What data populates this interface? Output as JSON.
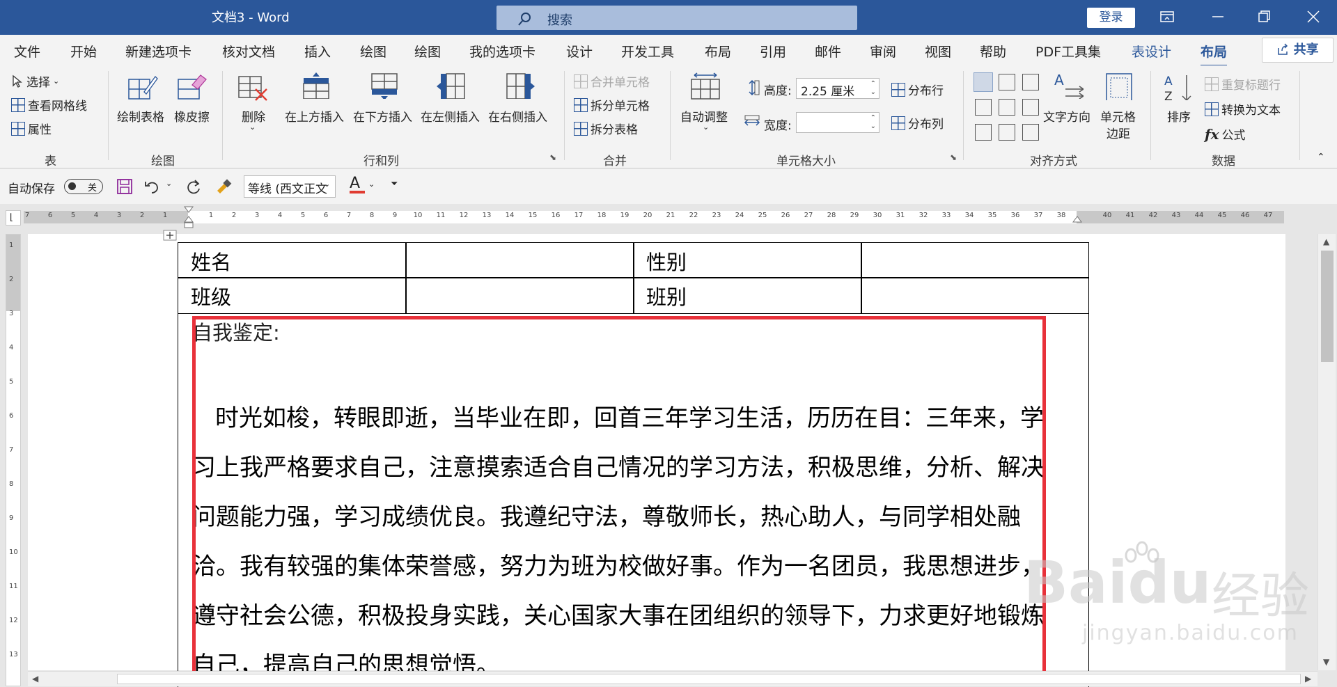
{
  "titlebar": {
    "doc_title": "文档3  -  Word",
    "search_placeholder": "搜索",
    "login_label": "登录"
  },
  "tabs": [
    {
      "label": "文件"
    },
    {
      "label": "开始"
    },
    {
      "label": "新建选项卡"
    },
    {
      "label": "核对文档"
    },
    {
      "label": "插入"
    },
    {
      "label": "绘图"
    },
    {
      "label": "绘图"
    },
    {
      "label": "我的选项卡"
    },
    {
      "label": "设计"
    },
    {
      "label": "开发工具"
    },
    {
      "label": "布局"
    },
    {
      "label": "引用"
    },
    {
      "label": "邮件"
    },
    {
      "label": "审阅"
    },
    {
      "label": "视图"
    },
    {
      "label": "帮助"
    },
    {
      "label": "PDF工具集"
    },
    {
      "label": "表设计"
    },
    {
      "label": "布局"
    }
  ],
  "share_label": "共享",
  "ribbon": {
    "table": {
      "select": "选择",
      "view_grid": "查看网格线",
      "properties": "属性",
      "group": "表"
    },
    "draw": {
      "draw_table": "绘制表格",
      "eraser": "橡皮擦",
      "group": "绘图"
    },
    "rows_cols": {
      "delete": "删除",
      "insert_above": "在上方插入",
      "insert_below": "在下方插入",
      "insert_left": "在左侧插入",
      "insert_right": "在右侧插入",
      "group": "行和列"
    },
    "merge": {
      "merge_cells": "合并单元格",
      "split_cells": "拆分单元格",
      "split_table": "拆分表格",
      "group": "合并"
    },
    "cell_size": {
      "autofit": "自动调整",
      "height_label": "高度:",
      "height_value": "2.25 厘米",
      "width_label": "宽度:",
      "width_value": "",
      "distribute_rows": "分布行",
      "distribute_cols": "分布列",
      "group": "单元格大小"
    },
    "alignment": {
      "text_direction": "文字方向",
      "cell_margins_1": "单元格",
      "cell_margins_2": "边距",
      "group": "对齐方式"
    },
    "data": {
      "sort": "排序",
      "repeat_header": "重复标题行",
      "convert_text": "转换为文本",
      "formula": "公式",
      "group": "数据"
    }
  },
  "qat": {
    "autosave_label": "自动保存",
    "autosave_state": "关",
    "font_name": "等线 (西文正文"
  },
  "ruler": {
    "left_numbers": [
      "7",
      "6",
      "5",
      "4",
      "3",
      "2",
      "1"
    ],
    "right_numbers": [
      "1",
      "2",
      "3",
      "4",
      "5",
      "6",
      "7",
      "8",
      "9",
      "10",
      "11",
      "12",
      "13",
      "14",
      "15",
      "16",
      "17",
      "18",
      "19",
      "20",
      "21",
      "22",
      "23",
      "24",
      "25",
      "26",
      "27",
      "28",
      "29",
      "30",
      "31",
      "32",
      "33",
      "34",
      "35",
      "36",
      "37",
      "38"
    ],
    "margin_numbers": [
      "40",
      "41",
      "42",
      "43",
      "44",
      "45",
      "46",
      "47"
    ]
  },
  "vruler_numbers": [
    "1",
    "2",
    "3",
    "4",
    "5",
    "6",
    "7",
    "8",
    "9",
    "10",
    "11",
    "12",
    "13"
  ],
  "table": {
    "row1": {
      "c1": "姓名",
      "c2": "",
      "c3": "性别",
      "c4": ""
    },
    "row2": {
      "c1": "班级",
      "c2": "",
      "c3": "班别",
      "c4": ""
    },
    "self_eval_title": "自我鉴定:",
    "self_eval_body": "时光如梭，转眼即逝，当毕业在即，回首三年学习生活，历历在目：三年来，学习上我严格要求自己，注意摸索适合自己情况的学习方法，积极思维，分析、解决问题能力强，学习成绩优良。我遵纪守法，尊敬师长，热心助人，与同学相处融洽。我有较强的集体荣誉感，努力为班为校做好事。作为一名团员，我思想进步，遵守社会公德，积极投身实践，关心国家大事在团组织的领导下，力求更好地锻炼自己，提高自己的思想觉悟。"
  },
  "watermark": {
    "brand": "Baidu",
    "cn": "经验",
    "url": "jingyan.baidu.com"
  },
  "colors": {
    "accent": "#2b579a",
    "highlight": "#e8313a"
  }
}
